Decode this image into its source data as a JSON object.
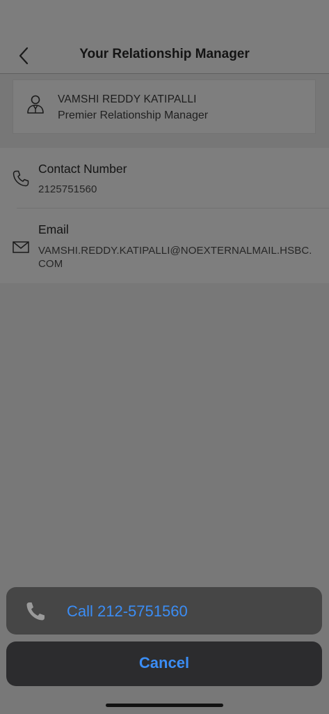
{
  "header": {
    "title": "Your Relationship Manager",
    "back_icon": "chevron-left-icon"
  },
  "manager": {
    "name": "VAMSHI REDDY KATIPALLI",
    "role": "Premier Relationship Manager",
    "avatar_icon": "person-tie-icon"
  },
  "contact": {
    "phone": {
      "title": "Contact Number",
      "value": "2125751560",
      "icon": "phone-icon"
    },
    "email": {
      "title": "Email",
      "value_line1": "VAMSHI.REDDY.KATIPALLI@NOEXTERNALMAIL.HSBC.",
      "value_line2": "COM",
      "icon": "envelope-icon"
    }
  },
  "action_sheet": {
    "call_label": "Call 212-5751560",
    "call_icon": "phone-icon",
    "cancel_label": "Cancel",
    "accent_color": "#3b8df5"
  }
}
